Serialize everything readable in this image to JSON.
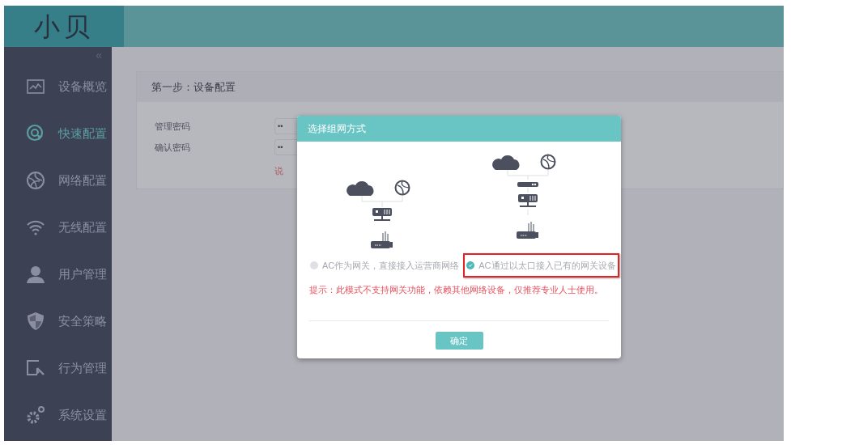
{
  "logo": {
    "text": "小贝"
  },
  "sidebar": {
    "collapse": "«",
    "items": [
      {
        "label": "设备概览",
        "selected": false
      },
      {
        "label": "快速配置",
        "selected": true
      },
      {
        "label": "网络配置",
        "selected": false
      },
      {
        "label": "无线配置",
        "selected": false
      },
      {
        "label": "用户管理",
        "selected": false
      },
      {
        "label": "安全策略",
        "selected": false
      },
      {
        "label": "行为管理",
        "selected": false
      },
      {
        "label": "系统设置",
        "selected": false
      }
    ]
  },
  "card": {
    "title": "第一步：设备配置",
    "fields": [
      {
        "label": "管理密码",
        "value": "••"
      },
      {
        "label": "确认密码",
        "value": "••"
      }
    ],
    "note": "说"
  },
  "dialog": {
    "title": "选择组网方式",
    "options": [
      {
        "label": "AC作为网关，直接接入运营商网络",
        "selected": false,
        "highlighted": false,
        "kind": "direct"
      },
      {
        "label": "AC通过以太口接入已有的网关设备",
        "selected": true,
        "highlighted": true,
        "kind": "via-gateway"
      }
    ],
    "hint": "提示：此模式不支持网关功能，依赖其他网络设备，仅推荐专业人士使用。",
    "button": "确定"
  }
}
